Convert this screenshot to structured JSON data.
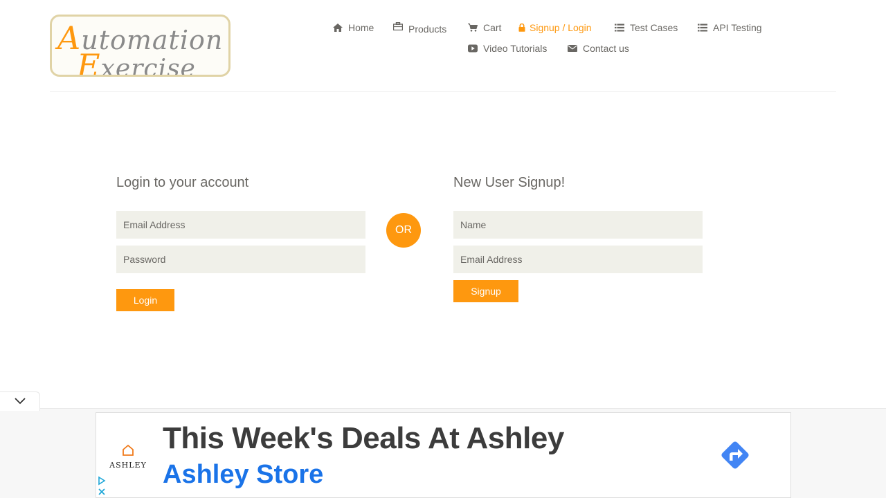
{
  "logo": {
    "line1_cap": "A",
    "line1_rest": "utomation",
    "line2_cap": "E",
    "line2_rest": "xercise"
  },
  "nav": {
    "items": [
      {
        "label": "Home",
        "icon": "home-icon"
      },
      {
        "label": "Products",
        "icon": "briefcase-icon"
      },
      {
        "label": "Cart",
        "icon": "cart-icon"
      },
      {
        "label": "Signup / Login",
        "icon": "lock-icon",
        "active": true
      },
      {
        "label": "Test Cases",
        "icon": "list-icon"
      },
      {
        "label": "API Testing",
        "icon": "list-icon"
      },
      {
        "label": "Video Tutorials",
        "icon": "youtube-play-icon"
      },
      {
        "label": "Contact us",
        "icon": "envelope-icon"
      }
    ]
  },
  "login": {
    "title": "Login to your account",
    "email_placeholder": "Email Address",
    "password_placeholder": "Password",
    "button": "Login"
  },
  "or_label": "OR",
  "signup": {
    "title": "New User Signup!",
    "name_placeholder": "Name",
    "email_placeholder": "Email Address",
    "button": "Signup"
  },
  "ad": {
    "brand": "ASHLEY",
    "headline": "This Week's Deals At Ashley",
    "subline": "Ashley Store",
    "cta_icon": "directions-arrow-icon",
    "info_icon": "adchoices-icon",
    "close_icon": "close-icon",
    "collapse_icon": "chevron-down-icon"
  },
  "colors": {
    "accent": "#fe980f",
    "field_bg": "#f0f0e9",
    "text": "#696763",
    "ad_link": "#1a73e8"
  }
}
